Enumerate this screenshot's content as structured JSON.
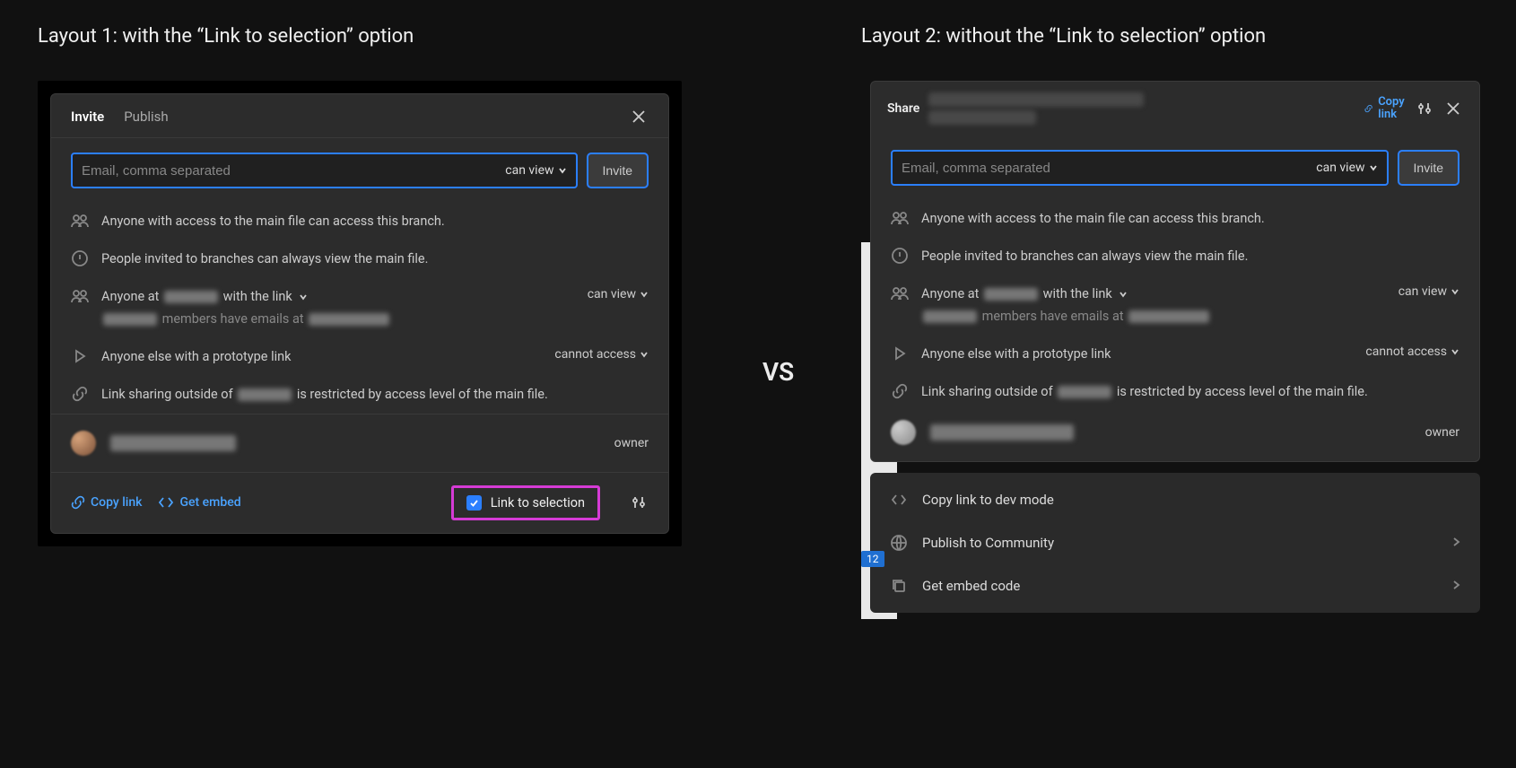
{
  "titles": {
    "layout1": "Layout 1: with the “Link to selection” option",
    "layout2": "Layout 2: without the “Link to selection” option",
    "vs": "VS"
  },
  "tabs": {
    "invite": "Invite",
    "publish": "Publish"
  },
  "invite": {
    "placeholder": "Email, comma separated",
    "perm": "can view",
    "button": "Invite"
  },
  "info": {
    "access_branch": "Anyone with access to the main file can access this branch.",
    "people_invited": "People invited to branches can always view the main file.",
    "anyone_at_pre": "Anyone at ",
    "anyone_at_post": " with the link",
    "members_pre": " members have emails at ",
    "anyone_proto": "Anyone else with a prototype link",
    "restr_pre": "Link sharing outside of ",
    "restr_post": " is restricted by access level of the main file."
  },
  "perms": {
    "can_view": "can view",
    "cannot_access": "cannot access",
    "owner": "owner"
  },
  "footer": {
    "copy_link": "Copy link",
    "get_embed": "Get embed",
    "link_to_selection": "Link to selection"
  },
  "layout2": {
    "share": "Share",
    "copy_link": "Copy link",
    "badge": "12"
  },
  "menu": {
    "dev": "Copy link to dev mode",
    "community": "Publish to Community",
    "embed": "Get embed code"
  }
}
